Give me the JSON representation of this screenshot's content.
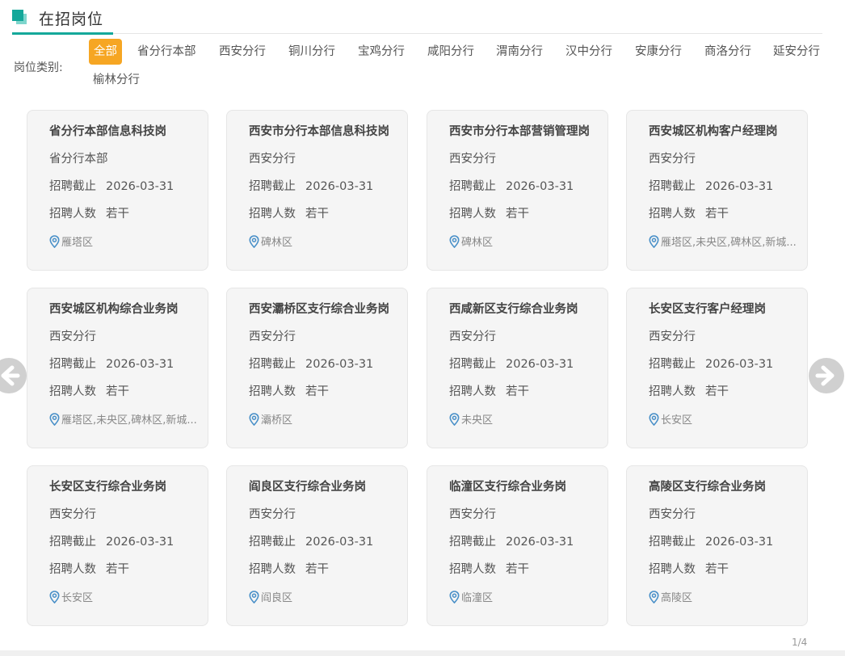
{
  "section": {
    "title": "在招岗位"
  },
  "filter": {
    "label": "岗位类别:",
    "chips": [
      "全部",
      "省分行本部",
      "西安分行",
      "铜川分行",
      "宝鸡分行",
      "咸阳分行",
      "渭南分行",
      "汉中分行",
      "安康分行",
      "商洛分行",
      "延安分行",
      "榆林分行"
    ],
    "active": "全部"
  },
  "labels": {
    "deadline": "招聘截止",
    "count": "招聘人数"
  },
  "jobs": [
    {
      "title": "省分行本部信息科技岗",
      "branch": "省分行本部",
      "deadline": "2026-03-31",
      "count": "若干",
      "location": "雁塔区"
    },
    {
      "title": "西安市分行本部信息科技岗",
      "branch": "西安分行",
      "deadline": "2026-03-31",
      "count": "若干",
      "location": "碑林区"
    },
    {
      "title": "西安市分行本部营销管理岗",
      "branch": "西安分行",
      "deadline": "2026-03-31",
      "count": "若干",
      "location": "碑林区"
    },
    {
      "title": "西安城区机构客户经理岗",
      "branch": "西安分行",
      "deadline": "2026-03-31",
      "count": "若干",
      "location": "雁塔区,未央区,碑林区,新城..."
    },
    {
      "title": "西安城区机构综合业务岗",
      "branch": "西安分行",
      "deadline": "2026-03-31",
      "count": "若干",
      "location": "雁塔区,未央区,碑林区,新城..."
    },
    {
      "title": "西安灞桥区支行综合业务岗",
      "branch": "西安分行",
      "deadline": "2026-03-31",
      "count": "若干",
      "location": "灞桥区"
    },
    {
      "title": "西咸新区支行综合业务岗",
      "branch": "西安分行",
      "deadline": "2026-03-31",
      "count": "若干",
      "location": "未央区"
    },
    {
      "title": "长安区支行客户经理岗",
      "branch": "西安分行",
      "deadline": "2026-03-31",
      "count": "若干",
      "location": "长安区"
    },
    {
      "title": "长安区支行综合业务岗",
      "branch": "西安分行",
      "deadline": "2026-03-31",
      "count": "若干",
      "location": "长安区"
    },
    {
      "title": "阎良区支行综合业务岗",
      "branch": "西安分行",
      "deadline": "2026-03-31",
      "count": "若干",
      "location": "阎良区"
    },
    {
      "title": "临潼区支行综合业务岗",
      "branch": "西安分行",
      "deadline": "2026-03-31",
      "count": "若干",
      "location": "临潼区"
    },
    {
      "title": "高陵区支行综合业务岗",
      "branch": "西安分行",
      "deadline": "2026-03-31",
      "count": "若干",
      "location": "高陵区"
    }
  ],
  "pagination": {
    "text": "1/4"
  },
  "colors": {
    "accent": "#14a89a",
    "active_chip": "#f6a623",
    "pin": "#4a90c8"
  }
}
